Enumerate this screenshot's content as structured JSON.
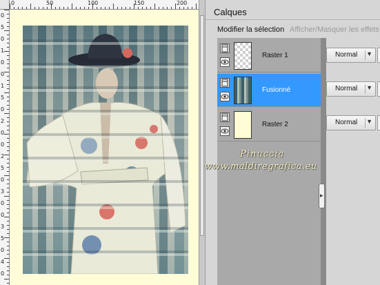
{
  "rulers": {
    "top_labels": [
      "0",
      "50",
      "100",
      "150",
      "200"
    ],
    "left_labels": [
      "0",
      "5",
      "0",
      "1",
      "0",
      "0",
      "1",
      "5",
      "0",
      "2",
      "0",
      "0",
      "2",
      "5",
      "0",
      "3",
      "0",
      "0",
      "3",
      "5",
      "0",
      "4",
      "0"
    ]
  },
  "canvas": {
    "background_color": "#fffdd8",
    "artwork_description_icon": "woman-in-floral-kimono-image"
  },
  "panel": {
    "title": "Calques",
    "toolbar": {
      "modify_selection": "Modifier la sélection",
      "toggle_effects": "Afficher/Masquer les effets"
    },
    "layers": [
      {
        "name": "Raster 1",
        "blend_mode": "Normal",
        "selected": false
      },
      {
        "name": "Fusionné",
        "blend_mode": "Normal",
        "selected": true
      },
      {
        "name": "Raster 2",
        "blend_mode": "Normal",
        "selected": false
      }
    ],
    "selection_color": "#3399ff"
  },
  "watermark": {
    "line1": "Pinuccia",
    "line2": "www.maldiregrafica.eu"
  }
}
